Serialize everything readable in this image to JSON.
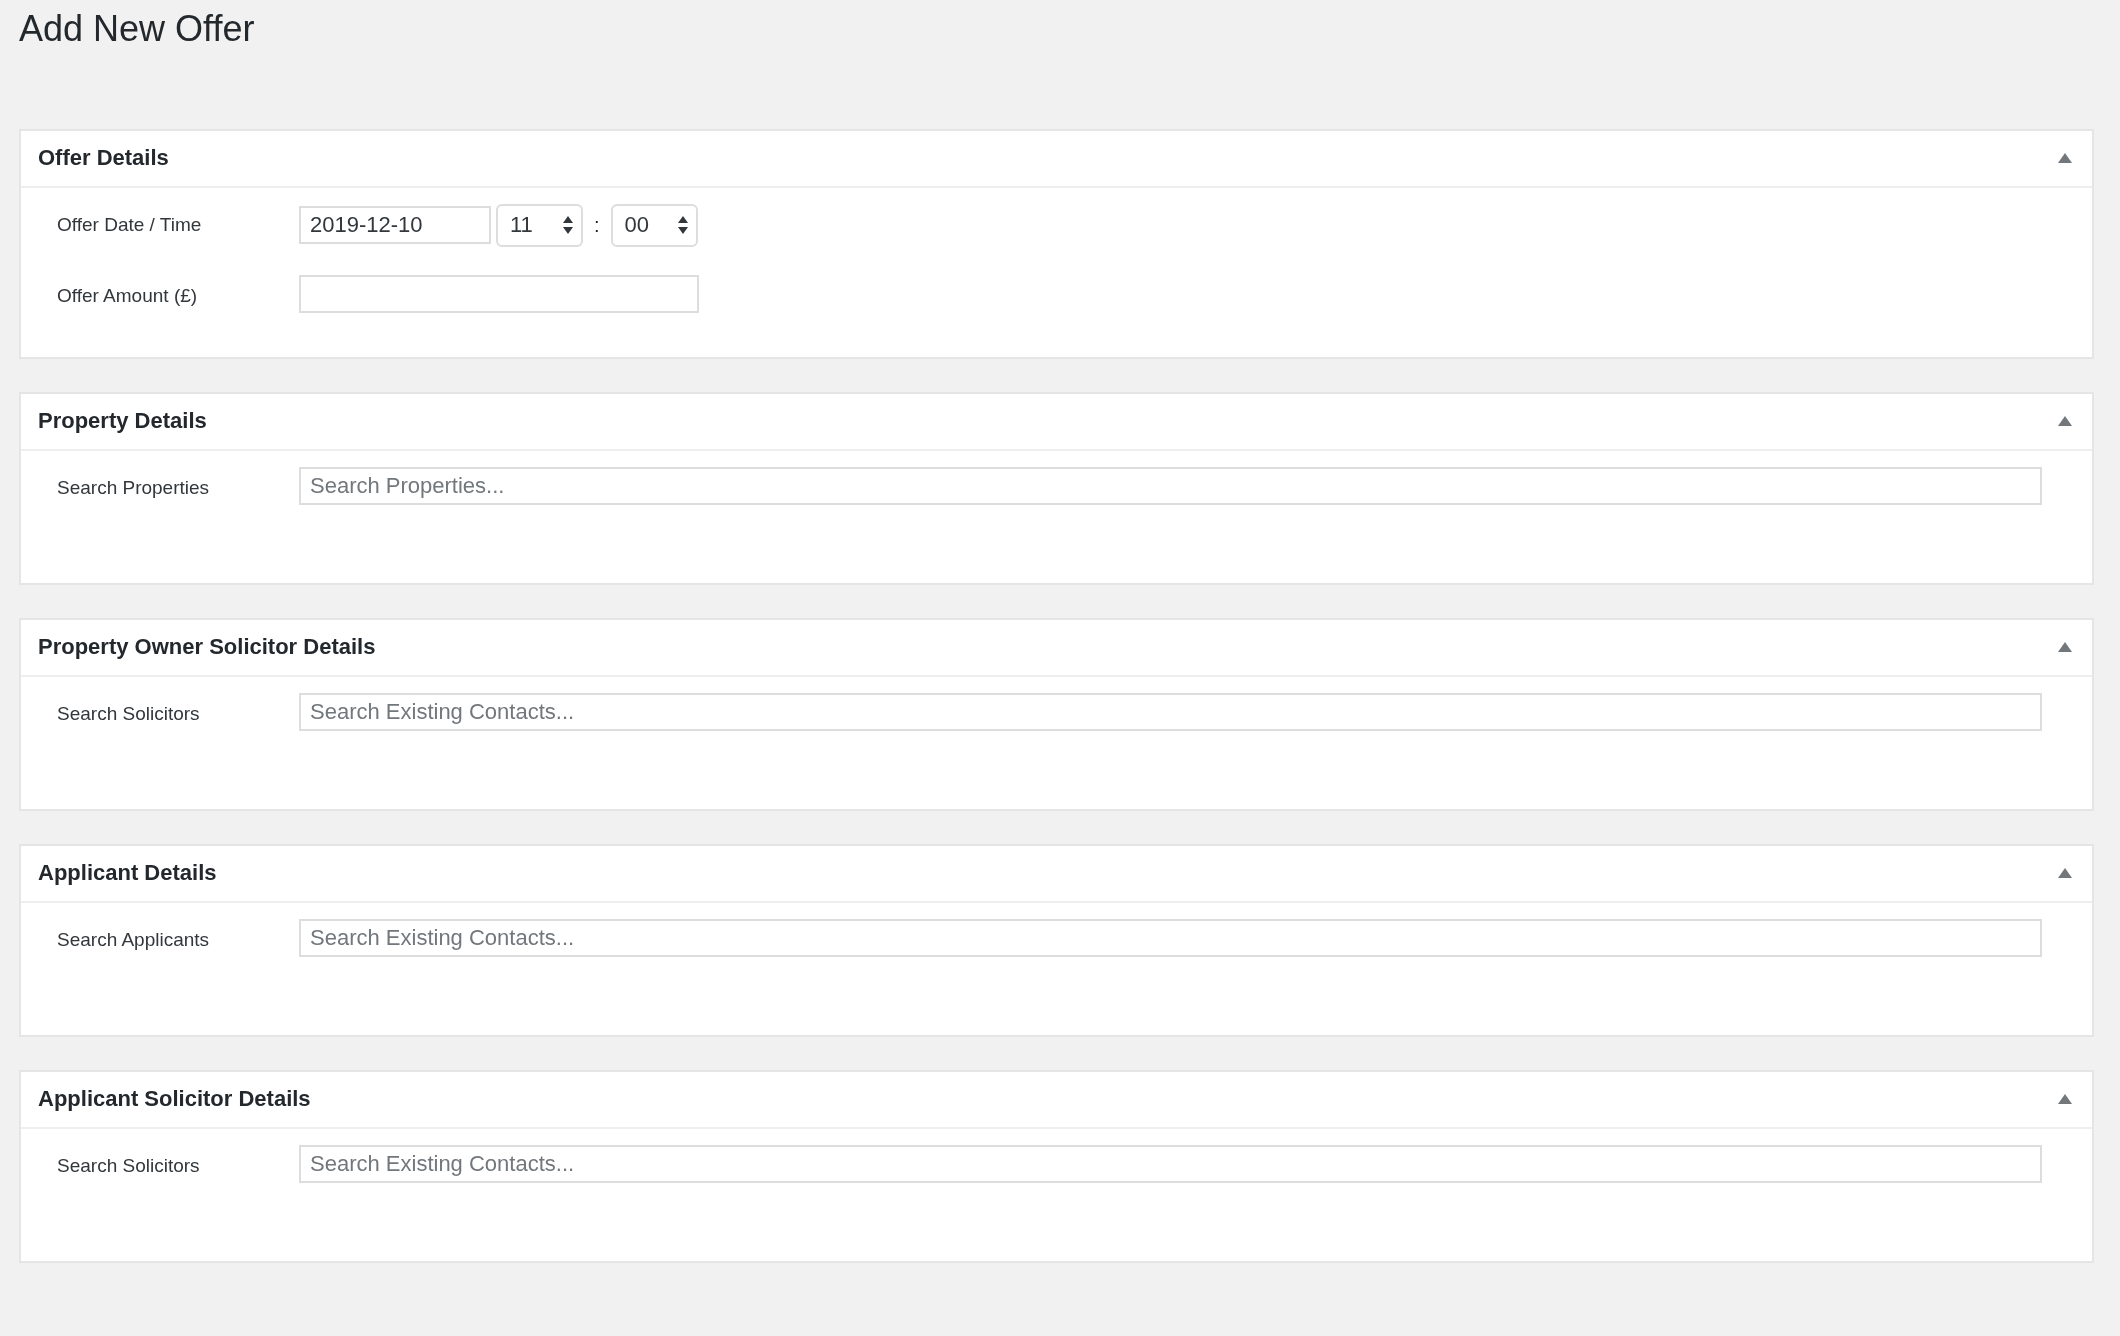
{
  "page_title": "Add New Offer",
  "panels": [
    {
      "title": "Offer Details",
      "expanded": true,
      "fields": [
        {
          "kind": "datetime",
          "label": "Offer Date / Time",
          "date": "2019-12-10",
          "hour": "11",
          "separator": ":",
          "minute": "00"
        },
        {
          "kind": "text",
          "label": "Offer Amount (£)"
        }
      ]
    },
    {
      "title": "Property Details",
      "expanded": true,
      "fields": [
        {
          "kind": "search",
          "label": "Search Properties",
          "placeholder": "Search Properties..."
        }
      ]
    },
    {
      "title": "Property Owner Solicitor Details",
      "expanded": true,
      "fields": [
        {
          "kind": "search",
          "label": "Search Solicitors",
          "placeholder": "Search Existing Contacts..."
        }
      ]
    },
    {
      "title": "Applicant Details",
      "expanded": true,
      "fields": [
        {
          "kind": "search",
          "label": "Search Applicants",
          "placeholder": "Search Existing Contacts..."
        }
      ]
    },
    {
      "title": "Applicant Solicitor Details",
      "expanded": true,
      "fields": [
        {
          "kind": "search",
          "label": "Search Solicitors",
          "placeholder": "Search Existing Contacts..."
        }
      ]
    }
  ]
}
